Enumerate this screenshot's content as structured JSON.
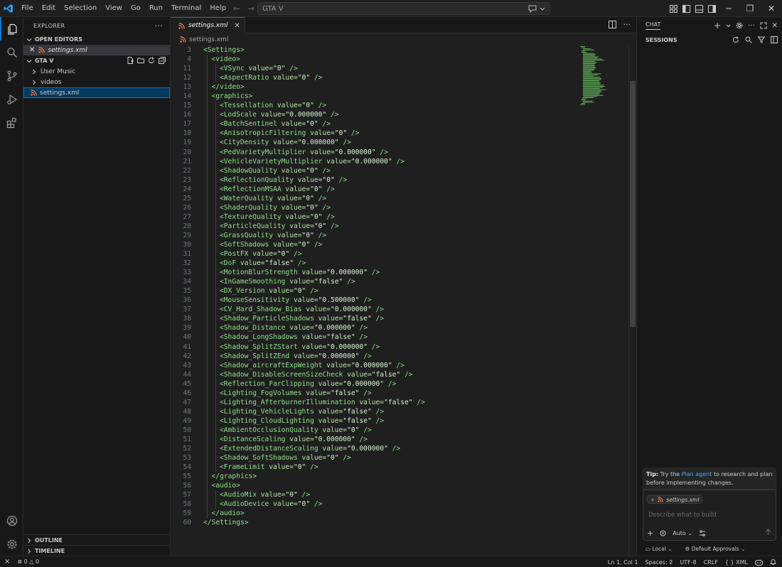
{
  "menu": [
    "File",
    "Edit",
    "Selection",
    "View",
    "Go",
    "Run",
    "Terminal",
    "Help"
  ],
  "command_center": {
    "text": "GTA V"
  },
  "sidebar": {
    "title": "EXPLORER",
    "open_editors_label": "OPEN EDITORS",
    "open_editor_file": "settings.xml",
    "workspace_label": "GTA V",
    "tree": [
      {
        "label": "User Music",
        "type": "folder"
      },
      {
        "label": "videos",
        "type": "folder"
      },
      {
        "label": "settings.xml",
        "type": "file"
      }
    ],
    "outline_label": "OUTLINE",
    "timeline_label": "TIMELINE"
  },
  "editor": {
    "tab_label": "settings.xml",
    "breadcrumb": "settings.xml",
    "lines": [
      {
        "n": 3,
        "indent": 0,
        "kind": "open",
        "tag": "Settings"
      },
      {
        "n": 4,
        "indent": 1,
        "kind": "open",
        "tag": "video"
      },
      {
        "n": 11,
        "indent": 2,
        "kind": "el",
        "tag": "VSync",
        "value": "0"
      },
      {
        "n": 12,
        "indent": 2,
        "kind": "el",
        "tag": "AspectRatio",
        "value": "0"
      },
      {
        "n": 13,
        "indent": 1,
        "kind": "close",
        "tag": "video"
      },
      {
        "n": 14,
        "indent": 1,
        "kind": "open",
        "tag": "graphics"
      },
      {
        "n": 15,
        "indent": 2,
        "kind": "el",
        "tag": "Tessellation",
        "value": "0"
      },
      {
        "n": 16,
        "indent": 2,
        "kind": "el",
        "tag": "LodScale",
        "value": "0.000000"
      },
      {
        "n": 17,
        "indent": 2,
        "kind": "el",
        "tag": "BatchSentinel",
        "value": "0"
      },
      {
        "n": 18,
        "indent": 2,
        "kind": "el",
        "tag": "AnisotropicFiltering",
        "value": "0"
      },
      {
        "n": 19,
        "indent": 2,
        "kind": "el",
        "tag": "CityDensity",
        "value": "0.000000"
      },
      {
        "n": 20,
        "indent": 2,
        "kind": "el",
        "tag": "PedVarietyMultiplier",
        "value": "0.000000"
      },
      {
        "n": 21,
        "indent": 2,
        "kind": "el",
        "tag": "VehicleVarietyMultiplier",
        "value": "0.000000"
      },
      {
        "n": 22,
        "indent": 2,
        "kind": "el",
        "tag": "ShadowQuality",
        "value": "0"
      },
      {
        "n": 23,
        "indent": 2,
        "kind": "el",
        "tag": "ReflectionQuality",
        "value": "0"
      },
      {
        "n": 24,
        "indent": 2,
        "kind": "el",
        "tag": "ReflectionMSAA",
        "value": "0"
      },
      {
        "n": 25,
        "indent": 2,
        "kind": "el",
        "tag": "WaterQuality",
        "value": "0"
      },
      {
        "n": 26,
        "indent": 2,
        "kind": "el",
        "tag": "ShaderQuality",
        "value": "0"
      },
      {
        "n": 27,
        "indent": 2,
        "kind": "el",
        "tag": "TextureQuality",
        "value": "0"
      },
      {
        "n": 28,
        "indent": 2,
        "kind": "el",
        "tag": "ParticleQuality",
        "value": "0"
      },
      {
        "n": 29,
        "indent": 2,
        "kind": "el",
        "tag": "GrassQuality",
        "value": "0"
      },
      {
        "n": 30,
        "indent": 2,
        "kind": "el",
        "tag": "SoftShadows",
        "value": "0"
      },
      {
        "n": 31,
        "indent": 2,
        "kind": "el",
        "tag": "PostFX",
        "value": "0"
      },
      {
        "n": 32,
        "indent": 2,
        "kind": "el",
        "tag": "DoF",
        "value": "false"
      },
      {
        "n": 33,
        "indent": 2,
        "kind": "el",
        "tag": "MotionBlurStrength",
        "value": "0.000000"
      },
      {
        "n": 34,
        "indent": 2,
        "kind": "el",
        "tag": "InGameSmoothing",
        "value": "false"
      },
      {
        "n": 35,
        "indent": 2,
        "kind": "el",
        "tag": "DX_Version",
        "value": "0"
      },
      {
        "n": 36,
        "indent": 2,
        "kind": "el",
        "tag": "MouseSensitivity",
        "value": "0.500000"
      },
      {
        "n": 37,
        "indent": 2,
        "kind": "el",
        "tag": "CV_Hard_Shadow_Bias",
        "value": "0.000000"
      },
      {
        "n": 38,
        "indent": 2,
        "kind": "el",
        "tag": "Shadow_ParticleShadows",
        "value": "false"
      },
      {
        "n": 39,
        "indent": 2,
        "kind": "el",
        "tag": "Shadow_Distance",
        "value": "0.000000"
      },
      {
        "n": 40,
        "indent": 2,
        "kind": "el",
        "tag": "Shadow_LongShadows",
        "value": "false"
      },
      {
        "n": 41,
        "indent": 2,
        "kind": "el",
        "tag": "Shadow_SplitZStart",
        "value": "0.000000"
      },
      {
        "n": 42,
        "indent": 2,
        "kind": "el",
        "tag": "Shadow_SplitZEnd",
        "value": "0.000000"
      },
      {
        "n": 43,
        "indent": 2,
        "kind": "el",
        "tag": "Shadow_aircraftExpWeight",
        "value": "0.000000"
      },
      {
        "n": 44,
        "indent": 2,
        "kind": "el",
        "tag": "Shadow_DisableScreenSizeCheck",
        "value": "false"
      },
      {
        "n": 45,
        "indent": 2,
        "kind": "el",
        "tag": "Reflection_FarClipping",
        "value": "0.000000"
      },
      {
        "n": 46,
        "indent": 2,
        "kind": "el",
        "tag": "Lighting_FogVolumes",
        "value": "false"
      },
      {
        "n": 47,
        "indent": 2,
        "kind": "el",
        "tag": "Lighting_AfterburnerIllumination",
        "value": "false"
      },
      {
        "n": 48,
        "indent": 2,
        "kind": "el",
        "tag": "Lighting_VehicleLights",
        "value": "false"
      },
      {
        "n": 49,
        "indent": 2,
        "kind": "el",
        "tag": "Lighting_CloudLighting",
        "value": "false"
      },
      {
        "n": 50,
        "indent": 2,
        "kind": "el",
        "tag": "AmbientOcclusionQuality",
        "value": "0"
      },
      {
        "n": 51,
        "indent": 2,
        "kind": "el",
        "tag": "DistanceScaling",
        "value": "0.000000"
      },
      {
        "n": 52,
        "indent": 2,
        "kind": "el",
        "tag": "ExtendedDistanceScaling",
        "value": "0.000000"
      },
      {
        "n": 53,
        "indent": 2,
        "kind": "el",
        "tag": "Shadow_SoftShadows",
        "value": "0"
      },
      {
        "n": 54,
        "indent": 2,
        "kind": "el",
        "tag": "FrameLimit",
        "value": "0"
      },
      {
        "n": 55,
        "indent": 1,
        "kind": "close",
        "tag": "graphics"
      },
      {
        "n": 56,
        "indent": 1,
        "kind": "open",
        "tag": "audio"
      },
      {
        "n": 57,
        "indent": 2,
        "kind": "el",
        "tag": "AudioMix",
        "value": "0"
      },
      {
        "n": 58,
        "indent": 2,
        "kind": "el",
        "tag": "AudioDevice",
        "value": "0"
      },
      {
        "n": 59,
        "indent": 1,
        "kind": "close",
        "tag": "audio"
      },
      {
        "n": 60,
        "indent": 0,
        "kind": "close",
        "tag": "Settings"
      }
    ]
  },
  "chat": {
    "title": "CHAT",
    "sessions_label": "SESSIONS",
    "tip_bold": "Tip:",
    "tip_pre": "Try the",
    "tip_link": "Plan agent",
    "tip_post": "to research and plan before implementing changes.",
    "context_file": "settings.xml",
    "placeholder": "Describe what to build",
    "mode_label": "Auto",
    "location_label": "Local",
    "approvals_label": "Default Approvals"
  },
  "status": {
    "errors": "0",
    "warnings": "0",
    "position": "Ln 1, Col 1",
    "spaces": "Spaces: 2",
    "encoding": "UTF-8",
    "eol": "CRLF",
    "language": "XML"
  },
  "colors": {
    "accent": "#0078d4",
    "tag": "#8fe28a",
    "xml_icon": "#e8744a"
  }
}
